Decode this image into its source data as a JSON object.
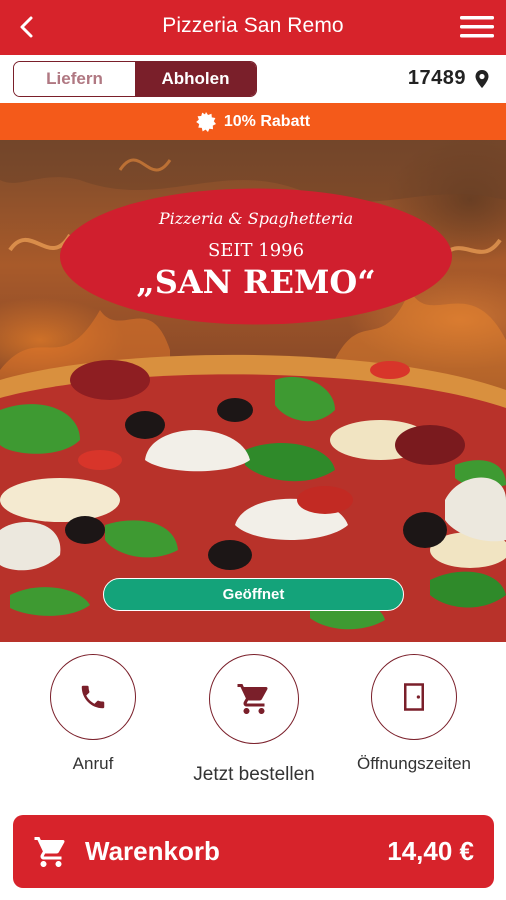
{
  "header": {
    "title": "Pizzeria San Remo"
  },
  "mode_toggle": {
    "deliver_label": "Liefern",
    "pickup_label": "Abholen",
    "selected": "Abholen"
  },
  "location": {
    "zip": "17489"
  },
  "promo": {
    "text": "10% Rabatt"
  },
  "hero": {
    "logo_line1": "Pizzeria & Spaghetteria",
    "logo_line2": "SEIT 1996",
    "logo_line3": "„SAN REMO“",
    "status": "Geöffnet"
  },
  "actions": [
    {
      "label": "Anruf",
      "icon": "phone-icon"
    },
    {
      "label": "Jetzt bestellen",
      "icon": "cart-icon"
    },
    {
      "label": "Öffnungszeiten",
      "icon": "door-icon"
    }
  ],
  "cart": {
    "label": "Warenkorb",
    "total": "14,40 €"
  },
  "colors": {
    "primary": "#d7232b",
    "dark": "#7a1f2a",
    "promo": "#f45a1a",
    "open": "#14a37a"
  }
}
